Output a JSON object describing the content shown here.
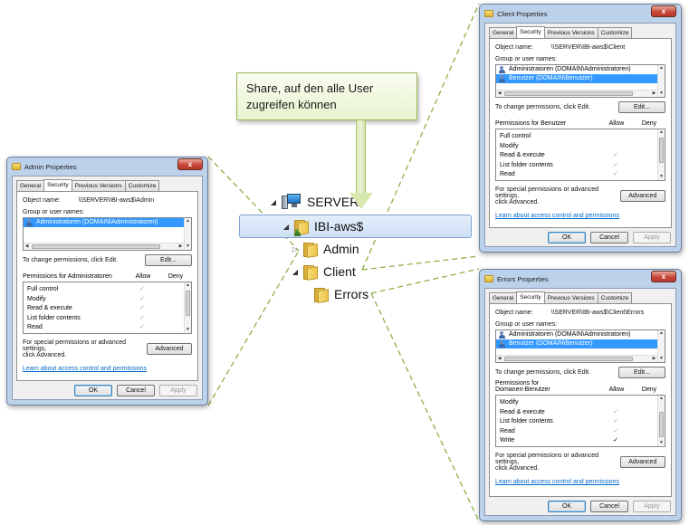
{
  "callout": {
    "text": "Share, auf den alle User zugreifen können"
  },
  "tree": [
    {
      "label": "SERVER",
      "expander": "◢"
    },
    {
      "label": "IBI-aws$",
      "expander": "◢"
    },
    {
      "label": "Admin",
      "expander": "▷"
    },
    {
      "label": "Client",
      "expander": "◢"
    },
    {
      "label": "Errors",
      "expander": ""
    }
  ],
  "tabs": [
    "General",
    "Security",
    "Previous Versions",
    "Customize"
  ],
  "common": {
    "object_name_label": "Object name:",
    "group_label": "Group or user names:",
    "change_text": "To change permissions, click Edit.",
    "edit_label": "Edit...",
    "allow": "Allow",
    "deny": "Deny",
    "special_text_1": "For special permissions or advanced settings,",
    "special_text_2": "click Advanced.",
    "advanced_label": "Advanced",
    "learn_link": "Learn about access control and permissions",
    "ok": "OK",
    "cancel": "Cancel",
    "apply": "Apply",
    "close": "x"
  },
  "admin": {
    "title": "Admin Properties",
    "object_name": "\\\\SERVER\\IBI-aws$\\Admin",
    "users": [
      "Administratoren (DOMAIN\\Administratoren)"
    ],
    "perm_label": "Permissions for Administratoren",
    "perms": [
      {
        "name": "Full control",
        "allow": "✓",
        "deny": ""
      },
      {
        "name": "Modify",
        "allow": "✓",
        "deny": ""
      },
      {
        "name": "Read & execute",
        "allow": "✓",
        "deny": ""
      },
      {
        "name": "List folder contents",
        "allow": "✓",
        "deny": ""
      },
      {
        "name": "Read",
        "allow": "✓",
        "deny": ""
      }
    ]
  },
  "client": {
    "title": "Client Properties",
    "object_name": "\\\\SERVER\\IBI-aws$\\Client",
    "users": [
      "Administratoren (DOMAIN\\Administratoren)",
      "Benutzer (DOMAIN\\Benutzer)"
    ],
    "perm_label": "Permissions for Benutzer",
    "perms": [
      {
        "name": "Full control",
        "allow": "",
        "deny": ""
      },
      {
        "name": "Modify",
        "allow": "",
        "deny": ""
      },
      {
        "name": "Read & execute",
        "allow": "✓",
        "deny": ""
      },
      {
        "name": "List folder contents",
        "allow": "✓",
        "deny": ""
      },
      {
        "name": "Read",
        "allow": "✓",
        "deny": ""
      }
    ]
  },
  "errors": {
    "title": "Errors Properties",
    "object_name": "\\\\SERVER\\IBI-aws$\\Client\\Errors",
    "users": [
      "Administratoren (DOMAIN\\Administratoren)",
      "Benutzer (DOMAIN\\Benutzer)"
    ],
    "perm_label_1": "Permissions for",
    "perm_label_2": "Domanen-Benutzer",
    "perms": [
      {
        "name": "Modify",
        "allow": "",
        "deny": ""
      },
      {
        "name": "Read & execute",
        "allow": "✓",
        "deny": ""
      },
      {
        "name": "List folder contents",
        "allow": "✓",
        "deny": ""
      },
      {
        "name": "Read",
        "allow": "✓",
        "deny": ""
      },
      {
        "name": "Write",
        "allow": "✓",
        "deny": ""
      }
    ]
  }
}
